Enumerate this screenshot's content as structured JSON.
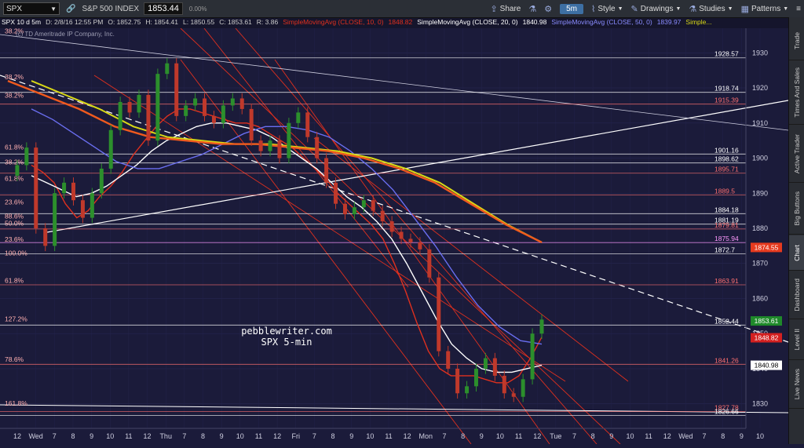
{
  "topbar": {
    "symbol": "SPX",
    "symbol_desc": "S&P 500 INDEX",
    "last_price": "1853.44",
    "change_pct": "0.00%",
    "timeframe": "5m",
    "buttons": [
      "Share",
      "Style",
      "Drawings",
      "Studies",
      "Patterns"
    ]
  },
  "infobar": {
    "label": "SPX 10 d 5m",
    "date": "D: 2/8/16 12:55 PM",
    "open": "O: 1852.75",
    "high": "H: 1854.41",
    "low": "L: 1850.55",
    "close": "C: 1853.61",
    "range": "R: 3.86",
    "sma10": "SimpleMovingAvg (CLOSE, 10, 0)",
    "sma10_val": "1848.82",
    "sma20": "SimpleMovingAvg (CLOSE, 20, 0)",
    "sma20_val": "1840.98",
    "sma50": "SimpleMovingAvg (CLOSE, 50, 0)",
    "sma50_val": "1839.97",
    "more": "Simple..."
  },
  "copyright": "(c) TD Ameritrade IP Company, Inc.",
  "side_tabs": [
    "Trade",
    "Times And Sales",
    "Active Trader",
    "Big Buttons",
    "Chart",
    "Dashboard",
    "Level II",
    "Live News"
  ],
  "colors": {
    "bg": "#1b1b3a",
    "candle_up": "#2c8f2c",
    "candle_down": "#c0392b",
    "red_line": "#e0301e",
    "yellow": "#d9d916",
    "blue": "#6a6ef0",
    "magenta": "#e050e0"
  },
  "chart_data": {
    "type": "line",
    "title": "pebblewriter.com",
    "subtitle": "SPX 5-min",
    "ylim": [
      1823,
      1937
    ],
    "yticks": [
      1830,
      1840,
      1850,
      1860,
      1870,
      1880,
      1890,
      1900,
      1910,
      1920,
      1930
    ],
    "xtick_labels": [
      "12",
      "Wed",
      "7",
      "8",
      "9",
      "10",
      "11",
      "12",
      "Thu",
      "7",
      "8",
      "9",
      "10",
      "11",
      "12",
      "Fri",
      "7",
      "8",
      "9",
      "10",
      "11",
      "12",
      "Mon",
      "7",
      "8",
      "9",
      "10",
      "11",
      "12",
      "Tue",
      "7",
      "8",
      "9",
      "10",
      "11",
      "12",
      "Wed",
      "7",
      "8",
      "9",
      "10"
    ],
    "series": [
      {
        "name": "SPX",
        "values": [
          1895,
          1898,
          1903,
          1880,
          1875,
          1890,
          1893,
          1888,
          1883,
          1890,
          1897,
          1908,
          1916,
          1913,
          1918,
          1905,
          1924,
          1927,
          1912,
          1915,
          1917,
          1912,
          1910,
          1915,
          1917,
          1914,
          1905,
          1902,
          1905,
          1900,
          1910,
          1913,
          1906,
          1900,
          1893,
          1887,
          1884,
          1886,
          1888,
          1885,
          1882,
          1879,
          1877,
          1876,
          1874,
          1866,
          1845,
          1840,
          1833,
          1835,
          1840,
          1843,
          1838,
          1833,
          1832,
          1837,
          1850,
          1854
        ]
      },
      {
        "name": "SimpleMovingAvg (CLOSE, 10, 0)",
        "values": [
          1898,
          1896,
          1893,
          1887,
          1883,
          1885,
          1889,
          1892,
          1896,
          1901,
          1905,
          1909,
          1912,
          1914,
          1914,
          1913,
          1912,
          1911,
          1910,
          1910,
          1909,
          1907,
          1905,
          1903,
          1900,
          1897,
          1894,
          1890,
          1887,
          1884,
          1881,
          1877,
          1870,
          1862,
          1853,
          1845,
          1840,
          1838,
          1838,
          1838,
          1837,
          1836,
          1836,
          1838,
          1843,
          1849
        ]
      },
      {
        "name": "SimpleMovingAvg (CLOSE, 20, 0)",
        "values": [
          1895,
          1893,
          1891,
          1889,
          1890,
          1892,
          1895,
          1898,
          1902,
          1905,
          1907,
          1909,
          1910,
          1910,
          1909,
          1908,
          1906,
          1903,
          1900,
          1897,
          1893,
          1889,
          1886,
          1882,
          1877,
          1870,
          1862,
          1854,
          1847,
          1843,
          1840,
          1839,
          1839,
          1840,
          1841
        ]
      },
      {
        "name": "SimpleMovingAvg (CLOSE, 50, 0)",
        "values": [
          1914,
          1911,
          1907,
          1903,
          1899,
          1897,
          1897,
          1899,
          1901,
          1904,
          1907,
          1909,
          1909,
          1908,
          1906,
          1902,
          1897,
          1891,
          1883,
          1875,
          1866,
          1858,
          1852,
          1848,
          1847
        ]
      },
      {
        "name": "Simple...",
        "values": [
          1922,
          1918,
          1914,
          1909,
          1906,
          1905,
          1904,
          1904,
          1903,
          1902,
          1900,
          1897,
          1893,
          1887,
          1881,
          1876
        ]
      }
    ],
    "hlines": [
      {
        "value": 1928.57,
        "label": "1928.57",
        "color": "#ffffff"
      },
      {
        "value": 1918.74,
        "label": "1918.74",
        "color": "#ffffff"
      },
      {
        "value": 1915.39,
        "label": "1915.39",
        "color": "#ff7070"
      },
      {
        "value": 1901.16,
        "label": "1901.16",
        "color": "#ffffff"
      },
      {
        "value": 1898.62,
        "label": "1898.62",
        "color": "#ffffff"
      },
      {
        "value": 1895.71,
        "label": "1895.71",
        "color": "#ff7070"
      },
      {
        "value": 1889.5,
        "label": "1889.5",
        "color": "#ff7070"
      },
      {
        "value": 1884.18,
        "label": "1884.18",
        "color": "#ffffff"
      },
      {
        "value": 1881.19,
        "label": "1881.19",
        "color": "#ffffff"
      },
      {
        "value": 1879.81,
        "label": "1879.81",
        "color": "#ff7070"
      },
      {
        "value": 1875.94,
        "label": "1875.94",
        "color": "#ff9aff"
      },
      {
        "value": 1872.7,
        "label": "1872.7",
        "color": "#ffffff"
      },
      {
        "value": 1863.91,
        "label": "1863.91",
        "color": "#ff7070"
      },
      {
        "value": 1852.44,
        "label": "1852.44",
        "color": "#ffffff"
      },
      {
        "value": 1841.26,
        "label": "1841.26",
        "color": "#ff7070"
      },
      {
        "value": 1827.78,
        "label": "1827.78",
        "color": "#ff7070"
      },
      {
        "value": 1826.66,
        "label": "1826.66",
        "color": "#ffffff"
      }
    ],
    "fib_labels": [
      "38.2%",
      "38.2%",
      "38.2%",
      "61.8%",
      "38.2%",
      "61.8%",
      "23.6%",
      "88.6%",
      "50.0%",
      "23.6%",
      "100.0%",
      "61.8%",
      "127.2%",
      "78.6%",
      "161.8%"
    ],
    "price_tags": [
      {
        "value": 1874.55,
        "label": "1874.55",
        "color": "#e63a1e"
      },
      {
        "value": 1853.61,
        "label": "1853.61",
        "color": "#1f8a2a"
      },
      {
        "value": 1848.82,
        "label": "1848.82",
        "color": "#d32020"
      },
      {
        "value": 1840.98,
        "label": "1840.98",
        "color": "#ffffff"
      }
    ]
  }
}
